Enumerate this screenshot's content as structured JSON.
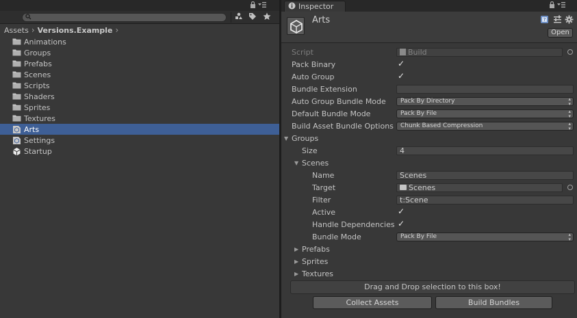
{
  "project_panel": {
    "breadcrumb": [
      "Assets",
      "Versions.Example"
    ],
    "items": [
      {
        "label": "Animations",
        "icon": "folder-icon"
      },
      {
        "label": "Groups",
        "icon": "folder-icon"
      },
      {
        "label": "Prefabs",
        "icon": "folder-icon"
      },
      {
        "label": "Scenes",
        "icon": "folder-icon"
      },
      {
        "label": "Scripts",
        "icon": "folder-icon"
      },
      {
        "label": "Shaders",
        "icon": "folder-icon"
      },
      {
        "label": "Sprites",
        "icon": "folder-icon"
      },
      {
        "label": "Textures",
        "icon": "folder-icon"
      },
      {
        "label": "Arts",
        "icon": "scriptable-object-icon",
        "selected": true
      },
      {
        "label": "Settings",
        "icon": "scriptable-object-icon"
      },
      {
        "label": "Startup",
        "icon": "unity-scene-icon"
      }
    ],
    "selected_color": "#3e5f96"
  },
  "inspector": {
    "tab_label": "Inspector",
    "object_title": "Arts",
    "open_label": "Open",
    "script_label": "Script",
    "script_value": "Build",
    "pack_binary_label": "Pack Binary",
    "pack_binary": true,
    "auto_group_label": "Auto Group",
    "auto_group": true,
    "bundle_extension_label": "Bundle Extension",
    "bundle_extension": "",
    "auto_group_bundle_mode_label": "Auto Group Bundle Mode",
    "auto_group_bundle_mode": "Pack By Directory",
    "default_bundle_mode_label": "Default Bundle Mode",
    "default_bundle_mode": "Pack By File",
    "build_options_label": "Build Asset Bundle Options",
    "build_options": "Chunk Based Compression",
    "groups_label": "Groups",
    "size_label": "Size",
    "size_value": "4",
    "scenes_group": {
      "label": "Scenes",
      "name_label": "Name",
      "name_value": "Scenes",
      "target_label": "Target",
      "target_value": "Scenes",
      "filter_label": "Filter",
      "filter_value": "t:Scene",
      "active_label": "Active",
      "active": true,
      "handle_deps_label": "Handle Dependencies",
      "handle_deps": true,
      "bundle_mode_label": "Bundle Mode",
      "bundle_mode": "Pack By File"
    },
    "collapsed_groups": [
      "Prefabs",
      "Sprites",
      "Textures"
    ],
    "drop_box_text": "Drag and Drop selection to this box!",
    "collect_assets_label": "Collect Assets",
    "build_bundles_label": "Build Bundles"
  }
}
